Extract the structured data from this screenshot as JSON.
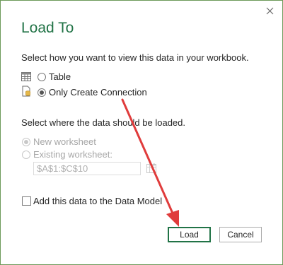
{
  "dialog": {
    "title": "Load To",
    "close_label": "×"
  },
  "view_section": {
    "heading": "Select how you want to view this data in your workbook.",
    "options": [
      {
        "label": "Table",
        "checked": false
      },
      {
        "label": "Only Create Connection",
        "checked": true
      }
    ]
  },
  "location_section": {
    "heading": "Select where the data should be loaded.",
    "new_worksheet_label": "New worksheet",
    "existing_worksheet_label": "Existing worksheet:",
    "range_value": "$A$1:$C$10"
  },
  "data_model": {
    "label": "Add this data to the Data Model"
  },
  "buttons": {
    "load": "Load",
    "cancel": "Cancel"
  },
  "colors": {
    "accent": "#217346",
    "annotation_arrow": "#e03c3c"
  }
}
